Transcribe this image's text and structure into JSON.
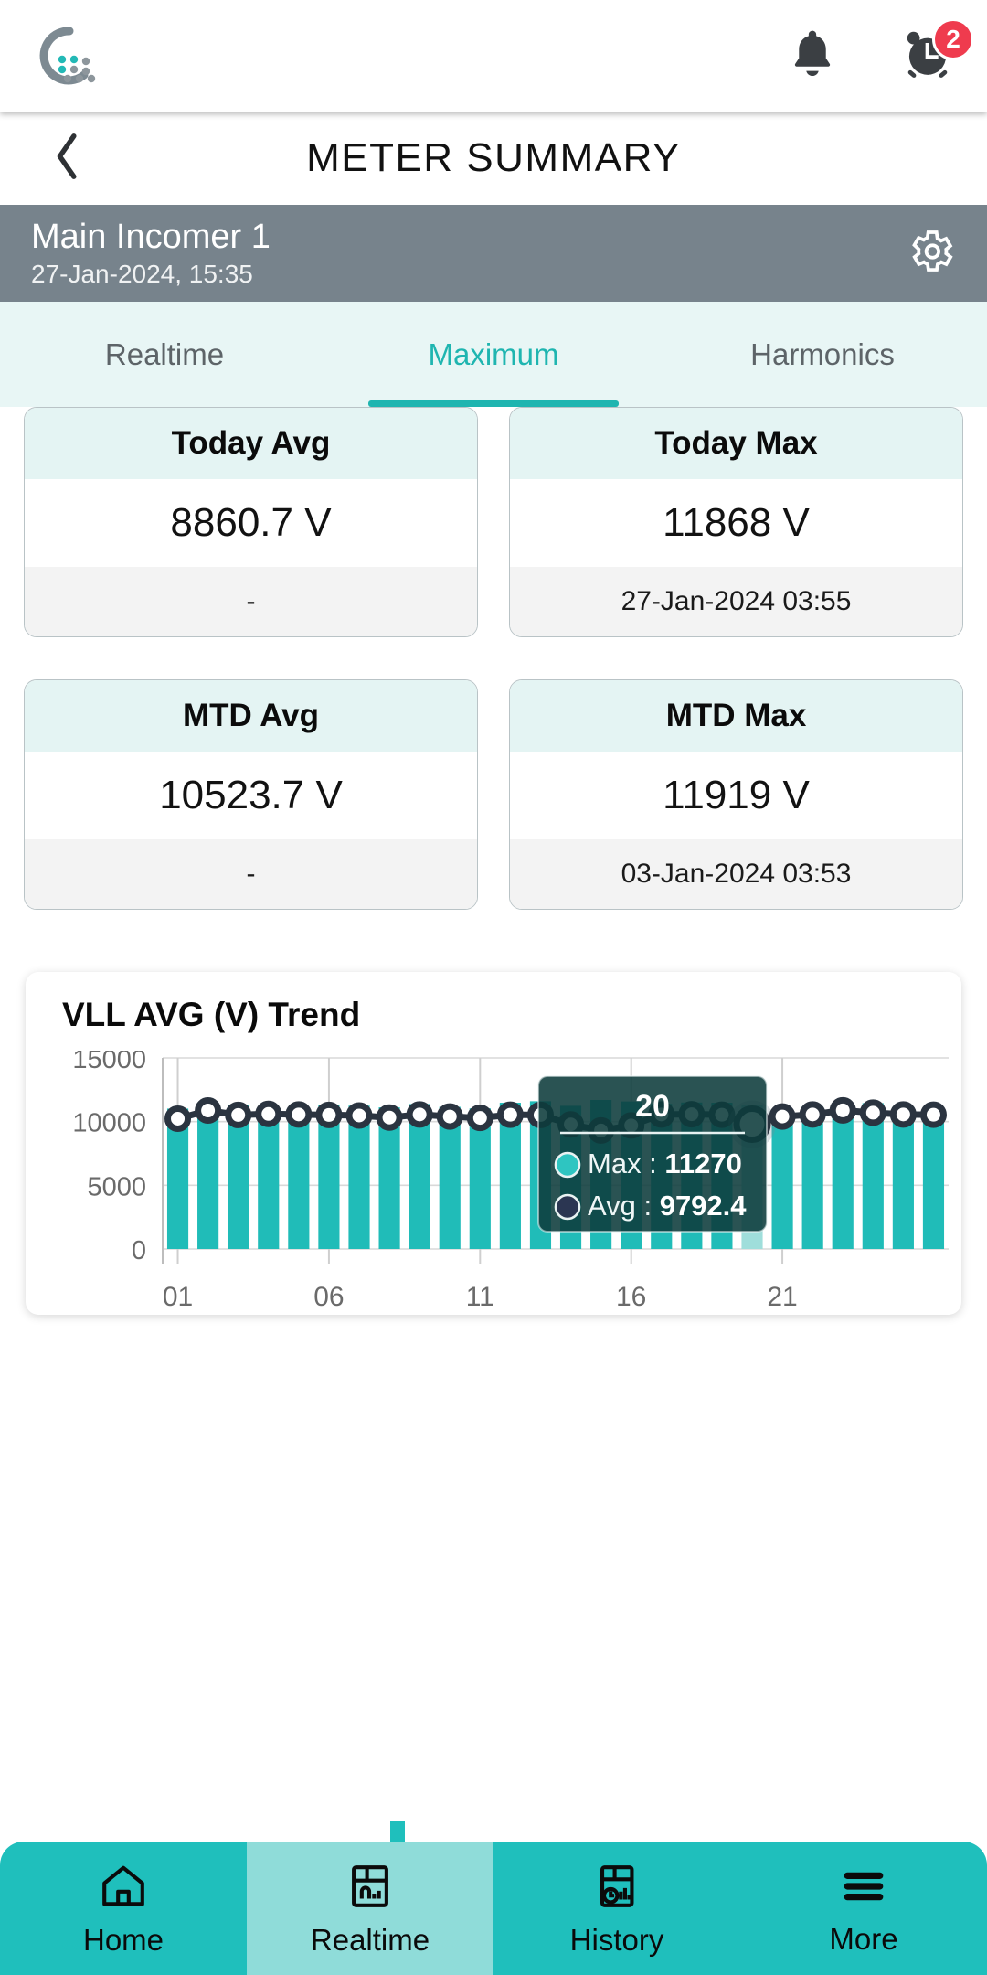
{
  "appbar": {
    "logo_name": "company-logo",
    "notifications_icon": "bell-icon",
    "alarms_icon": "alarm-clock-icon",
    "alarm_badge_count": "2"
  },
  "titlebar": {
    "back_icon": "chevron-left-icon",
    "title": "METER SUMMARY"
  },
  "meterbar": {
    "name": "Main Incomer 1",
    "timestamp": "27-Jan-2024, 15:35",
    "settings_icon": "gear-icon"
  },
  "tabs": [
    {
      "label": "Realtime",
      "active": false
    },
    {
      "label": "Maximum",
      "active": true
    },
    {
      "label": "Harmonics",
      "active": false
    }
  ],
  "cards": [
    {
      "title": "Today Avg",
      "value": "8860.7 V",
      "footer": "-"
    },
    {
      "title": "Today Max",
      "value": "11868 V",
      "footer": "27-Jan-2024 03:55"
    },
    {
      "title": "MTD Avg",
      "value": "10523.7 V",
      "footer": "-"
    },
    {
      "title": "MTD Max",
      "value": "11919 V",
      "footer": "03-Jan-2024 03:53"
    }
  ],
  "bottomnav": [
    {
      "label": "Home",
      "icon": "home-icon",
      "active": false
    },
    {
      "label": "Realtime",
      "icon": "realtime-meter-icon",
      "active": true
    },
    {
      "label": "History",
      "icon": "history-chart-icon",
      "active": false
    },
    {
      "label": "More",
      "icon": "hamburger-menu-icon",
      "active": false
    }
  ],
  "colors": {
    "accent_teal": "#1fbfbc",
    "bar_teal": "#20bcb8",
    "bar_highlight": "#9fdedb",
    "line_navy": "#2b3440",
    "meterbar_gray": "#77838c",
    "tab_bg": "#e8f6f5",
    "badge_red": "#ef3b4e",
    "tooltip_bg": "#0d3b3b"
  },
  "chart_data": {
    "type": "bar",
    "title": "VLL AVG (V) Trend",
    "xlabel": "",
    "ylabel": "",
    "ylim": [
      0,
      15000
    ],
    "yticks": [
      "0",
      "5000",
      "10000",
      "15000"
    ],
    "ytick_values": [
      0,
      5000,
      10000,
      15000
    ],
    "xticks": [
      "01",
      "06",
      "11",
      "16",
      "21"
    ],
    "xtick_values": [
      1,
      6,
      11,
      16,
      21
    ],
    "grid": true,
    "legend_position": "none",
    "categories": [
      1,
      2,
      3,
      4,
      5,
      6,
      7,
      8,
      9,
      10,
      11,
      12,
      13,
      14,
      15,
      16,
      17,
      18,
      19,
      20,
      21,
      22,
      23,
      24,
      25,
      26
    ],
    "series": [
      {
        "name": "Max",
        "type": "bar",
        "color": "#20bcb8",
        "values": [
          11020,
          11500,
          11290,
          11210,
          11130,
          11280,
          11250,
          11120,
          11380,
          11160,
          11040,
          11480,
          11600,
          11240,
          11700,
          11580,
          11390,
          11500,
          11480,
          11270,
          10980,
          11200,
          11320,
          11450,
          11180,
          11060
        ]
      },
      {
        "name": "Avg",
        "type": "line",
        "color": "#2b3440",
        "values": [
          10230,
          10870,
          10520,
          10600,
          10560,
          10520,
          10480,
          10320,
          10560,
          10400,
          10290,
          10540,
          10520,
          9780,
          9300,
          9700,
          10560,
          10580,
          10540,
          9792.4,
          10400,
          10560,
          10880,
          10700,
          10560,
          10540
        ]
      }
    ],
    "highlighted_index": 20,
    "tooltip": {
      "title": "20",
      "rows": [
        {
          "label": "Max",
          "value": "11270",
          "marker_color": "#2ec5c1"
        },
        {
          "label": "Avg",
          "value": "9792.4",
          "marker_color": "#2b3652"
        }
      ]
    }
  }
}
